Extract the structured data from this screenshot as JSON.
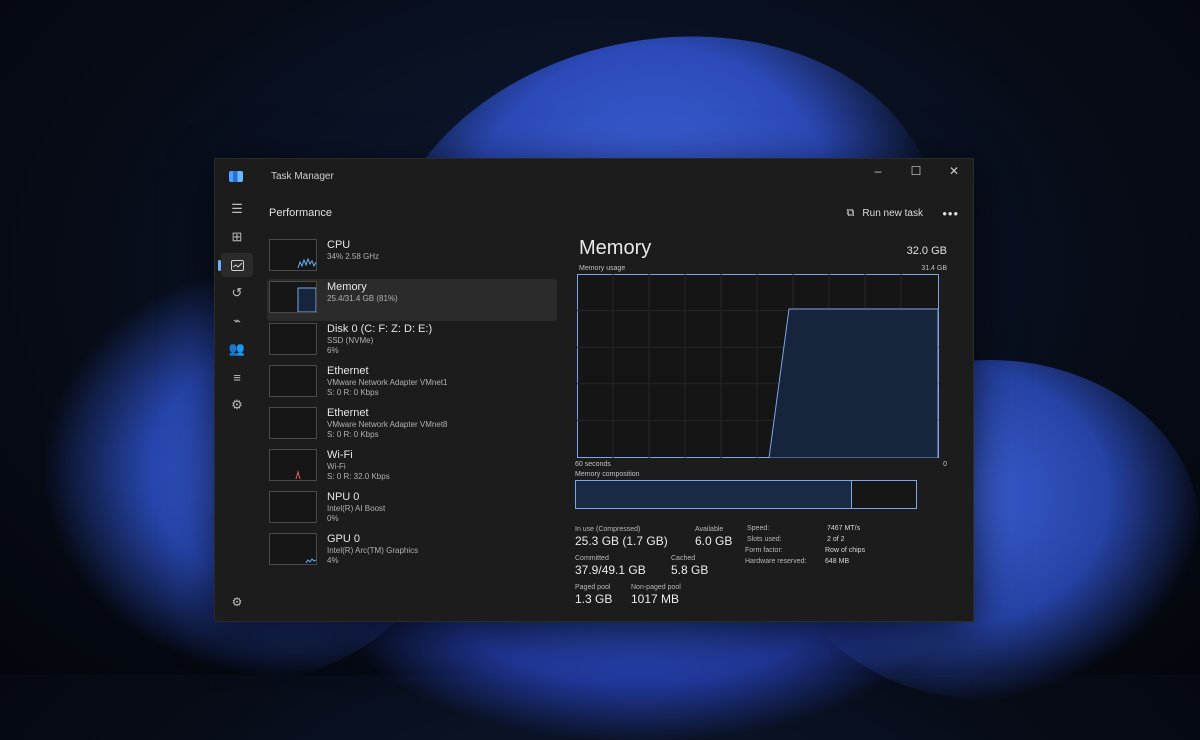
{
  "window": {
    "title": "Task Manager",
    "minimize": "–",
    "maximize": "☐",
    "close": "✕"
  },
  "header": {
    "page_title": "Performance",
    "run_new_task": "Run new task",
    "more": "•••"
  },
  "devices": [
    {
      "name": "CPU",
      "sub1": "34%  2.58 GHz",
      "sub2": ""
    },
    {
      "name": "Memory",
      "sub1": "25.4/31.4 GB (81%)",
      "sub2": ""
    },
    {
      "name": "Disk 0 (C: F: Z: D: E:)",
      "sub1": "SSD (NVMe)",
      "sub2": "6%"
    },
    {
      "name": "Ethernet",
      "sub1": "VMware Network Adapter VMnet1",
      "sub2": "S: 0  R: 0 Kbps"
    },
    {
      "name": "Ethernet",
      "sub1": "VMware Network Adapter VMnet8",
      "sub2": "S: 0  R: 0 Kbps"
    },
    {
      "name": "Wi-Fi",
      "sub1": "Wi-Fi",
      "sub2": "S: 0  R: 32.0 Kbps"
    },
    {
      "name": "NPU 0",
      "sub1": "Intel(R) AI Boost",
      "sub2": "0%"
    },
    {
      "name": "GPU 0",
      "sub1": "Intel(R) Arc(TM) Graphics",
      "sub2": "4%"
    }
  ],
  "detail": {
    "title": "Memory",
    "total": "32.0 GB",
    "usage_label": "Memory usage",
    "usage_max": "31.4 GB",
    "axis_left": "60 seconds",
    "axis_right": "0",
    "composition_label": "Memory composition",
    "in_use_fraction": 0.81
  },
  "stats": {
    "in_use_label": "In use (Compressed)",
    "in_use_value": "25.3 GB (1.7 GB)",
    "available_label": "Available",
    "available_value": "6.0 GB",
    "committed_label": "Committed",
    "committed_value": "37.9/49.1 GB",
    "cached_label": "Cached",
    "cached_value": "5.8 GB",
    "paged_label": "Paged pool",
    "paged_value": "1.3 GB",
    "nonpaged_label": "Non-paged pool",
    "nonpaged_value": "1017 MB"
  },
  "properties": {
    "speed_label": "Speed:",
    "speed_value": "7467 MT/s",
    "slots_label": "Slots used:",
    "slots_value": "2 of 2",
    "form_label": "Form factor:",
    "form_value": "Row of chips",
    "reserved_label": "Hardware reserved:",
    "reserved_value": "648 MB"
  },
  "colors": {
    "accent": "#6ab0ff",
    "chart_line": "#7da6e6",
    "chart_fill": "#16243c"
  }
}
